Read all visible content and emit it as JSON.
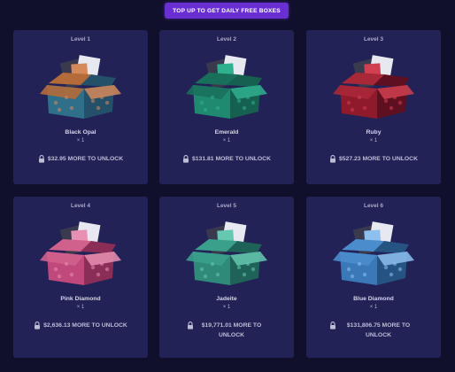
{
  "top_button": "TOP UP TO GET DAILY FREE BOXES",
  "boxes": [
    {
      "level": "Level 1",
      "name": "Black Opal",
      "qty": "× 1",
      "unlock": "$32.95 MORE TO UNLOCK",
      "colors": {
        "front": "#2f6f8a",
        "side": "#24506a",
        "lid": "#b56a3a",
        "accent": "#d68a5a"
      }
    },
    {
      "level": "Level 2",
      "name": "Emerald",
      "qty": "× 1",
      "unlock": "$131.81 MORE TO UNLOCK",
      "colors": {
        "front": "#1f8a70",
        "side": "#15604f",
        "lid": "#18705b",
        "accent": "#2fb08f"
      }
    },
    {
      "level": "Level 3",
      "name": "Ruby",
      "qty": "× 1",
      "unlock": "$527.23 MORE TO UNLOCK",
      "colors": {
        "front": "#8f1a2c",
        "side": "#5f1020",
        "lid": "#a82838",
        "accent": "#d04050"
      }
    },
    {
      "level": "Level 4",
      "name": "Pink Diamond",
      "qty": "× 1",
      "unlock": "$2,636.13 MORE TO UNLOCK",
      "colors": {
        "front": "#c0487a",
        "side": "#8a2d57",
        "lid": "#d0608c",
        "accent": "#e890b4"
      }
    },
    {
      "level": "Level 5",
      "name": "Jadeite",
      "qty": "× 1",
      "unlock": "$19,771.01 MORE TO UNLOCK",
      "colors": {
        "front": "#2f8a7a",
        "side": "#1f6257",
        "lid": "#3aa08c",
        "accent": "#66c8b0"
      }
    },
    {
      "level": "Level 6",
      "name": "Blue Diamond",
      "qty": "× 1",
      "unlock": "$131,806.75 MORE TO UNLOCK",
      "colors": {
        "front": "#3a78b8",
        "side": "#265482",
        "lid": "#4a8ccc",
        "accent": "#8ec0ee"
      }
    }
  ],
  "lock_icon": "lock-icon"
}
